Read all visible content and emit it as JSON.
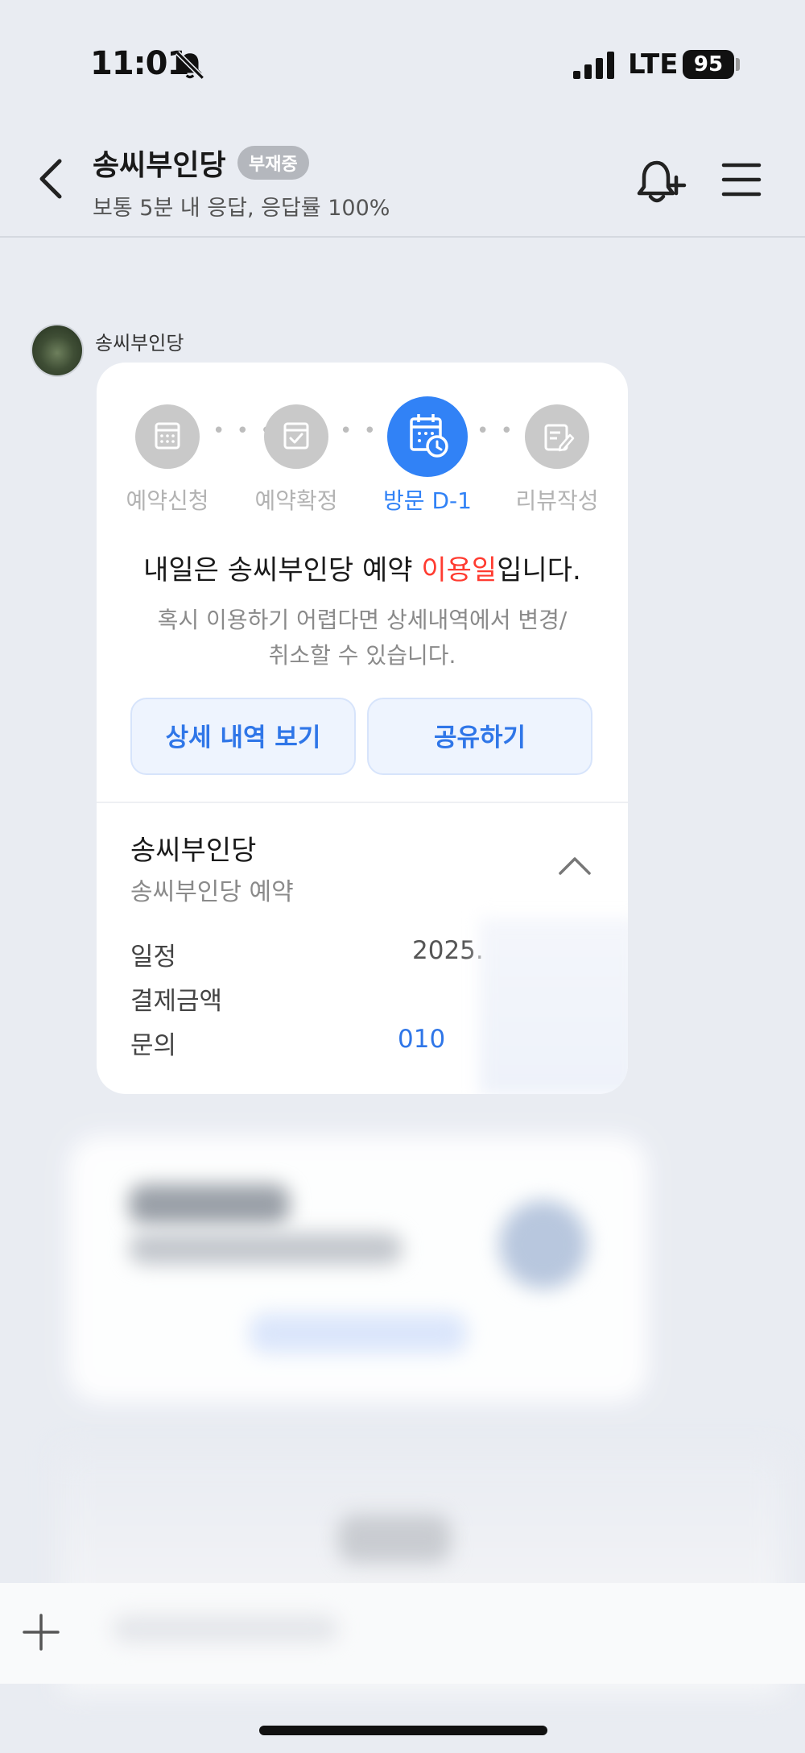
{
  "status_bar": {
    "time": "11:01",
    "network": "LTE",
    "battery": "95"
  },
  "header": {
    "title": "송씨부인당",
    "badge": "부재중",
    "response_info": "보통 5분 내 응답, 응답률 100%"
  },
  "message": {
    "sender_name": "송씨부인당"
  },
  "card": {
    "steps": [
      {
        "label": "예약신청",
        "active": false,
        "icon": "calendar-grid-icon"
      },
      {
        "label": "예약확정",
        "active": false,
        "icon": "calendar-check-icon"
      },
      {
        "label": "방문 D-1",
        "active": true,
        "icon": "calendar-clock-icon"
      },
      {
        "label": "리뷰작성",
        "active": false,
        "icon": "review-edit-icon"
      }
    ],
    "main_message_before": "내일은 송씨부인당 예약 ",
    "main_message_highlight": "이용일",
    "main_message_after": "입니다.",
    "sub_message_line1": "혹시 이용하기 어렵다면 상세내역에서 변경/",
    "sub_message_line2": "취소할 수 있습니다.",
    "buttons": {
      "details": "상세 내역 보기",
      "share": "공유하기"
    },
    "place_name": "송씨부인당",
    "place_desc": "송씨부인당 예약",
    "details": [
      {
        "label": "일정",
        "value": "2025."
      },
      {
        "label": "결제금액",
        "value": ""
      },
      {
        "label": "문의",
        "value": "010"
      }
    ],
    "colors": {
      "accent": "#2f76e8",
      "highlight": "#ff3b30",
      "active_step": "#3182f6"
    }
  }
}
